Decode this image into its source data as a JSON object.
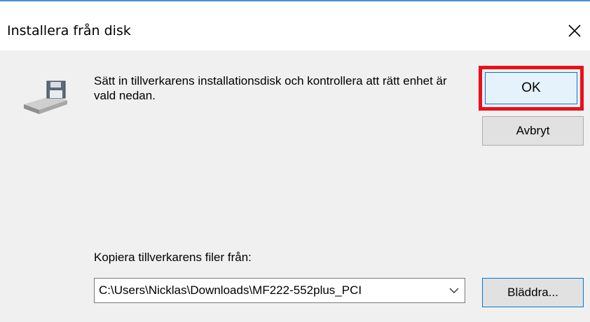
{
  "dialog": {
    "title": "Installera från disk",
    "message": "Sätt in tillverkarens installationsdisk och kontrollera att rätt enhet är vald nedan.",
    "ok_label": "OK",
    "cancel_label": "Avbryt",
    "copy_from_label": "Kopiera tillverkarens filer från:",
    "path_value": "C:\\Users\\Nicklas\\Downloads\\MF222-552plus_PCI",
    "browse_label": "Bläddra...",
    "icons": {
      "close": "close-icon",
      "disk": "install-disk-icon",
      "dropdown": "chevron-down-icon"
    },
    "colors": {
      "highlight": "#e8111a",
      "focus_border": "#0078d7",
      "dialog_background": "#f0f0f0"
    }
  }
}
